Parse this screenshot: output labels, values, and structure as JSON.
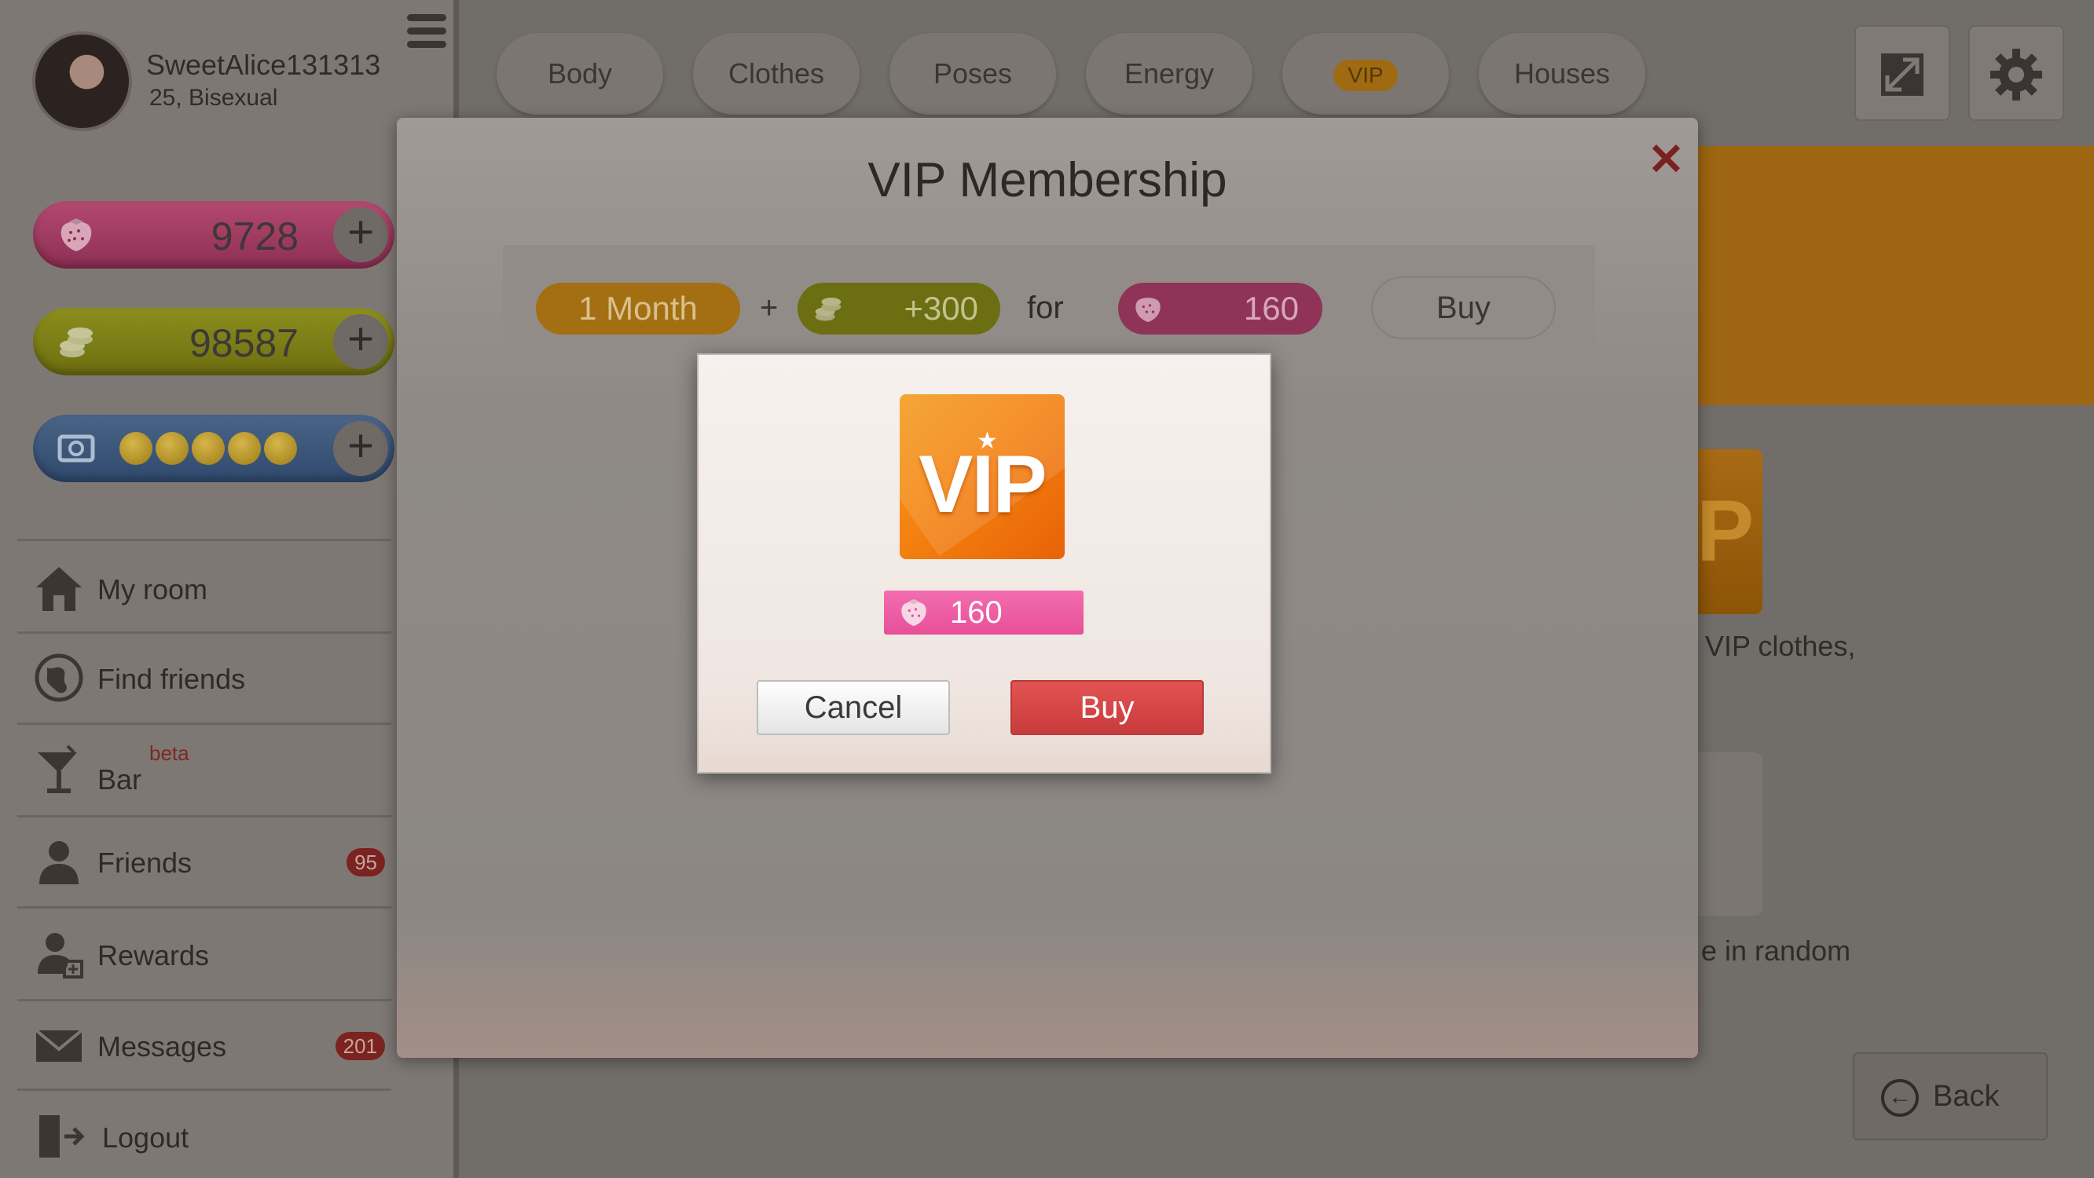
{
  "user": {
    "name": "SweetAlice131313",
    "info": "25, Bisexual"
  },
  "currencies": {
    "strawberries": {
      "value": "9728",
      "plus_label": "+"
    },
    "coins": {
      "value": "98587",
      "plus_label": "+"
    },
    "tickets": {
      "filled": 5,
      "plus_label": "+"
    }
  },
  "nav": {
    "items": [
      {
        "label": "My room",
        "icon": "house-icon"
      },
      {
        "label": "Find friends",
        "icon": "globe-icon"
      },
      {
        "label": "Bar",
        "icon": "cocktail-icon",
        "tag": "beta"
      },
      {
        "label": "Friends",
        "icon": "person-icon",
        "badge": "95"
      },
      {
        "label": "Rewards",
        "icon": "reward-person-icon"
      },
      {
        "label": "Messages",
        "icon": "envelope-icon",
        "badge": "201"
      },
      {
        "label": "Logout",
        "icon": "logout-icon"
      }
    ]
  },
  "tabs": [
    {
      "label": "Body"
    },
    {
      "label": "Clothes"
    },
    {
      "label": "Poses"
    },
    {
      "label": "Energy"
    },
    {
      "label": "VIP"
    },
    {
      "label": "Houses"
    }
  ],
  "top_icons": {
    "fullscreen": "fullscreen-icon",
    "settings": "gear-icon"
  },
  "background": {
    "vip_icon_fragment": "P",
    "text1": "VIP clothes,",
    "text2": "e in random",
    "back_label": "Back"
  },
  "modal": {
    "title": "VIP Membership",
    "close": "✕",
    "offer": {
      "duration": "1 Month",
      "plus": "+",
      "coins": "+300",
      "for": "for",
      "price": "160",
      "buy": "Buy"
    }
  },
  "dialog": {
    "icon_text": "VIP",
    "price": "160",
    "cancel": "Cancel",
    "buy": "Buy"
  },
  "colors": {
    "accent_orange": "#f48210",
    "price_pink": "#e84f98",
    "buy_red": "#d54546"
  }
}
